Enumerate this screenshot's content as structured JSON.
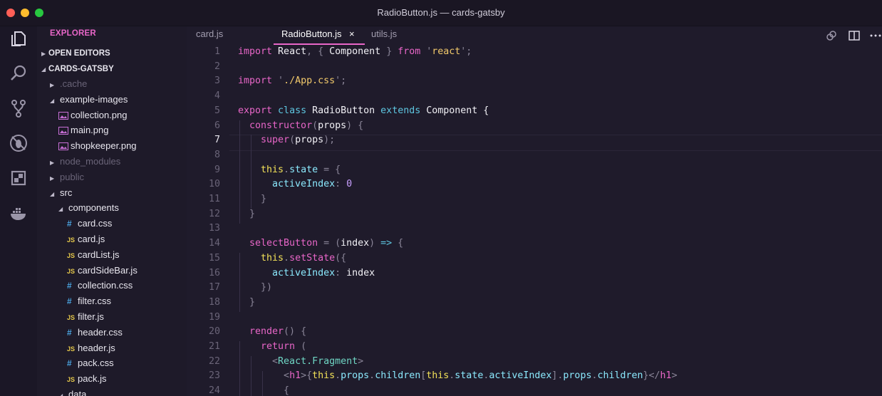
{
  "window": {
    "title": "RadioButton.js — cards-gatsby"
  },
  "activity_bar": [
    "files-icon",
    "search-icon",
    "source-control-icon",
    "debug-icon",
    "extensions-icon",
    "docker-icon"
  ],
  "sidebar": {
    "title": "EXPLORER",
    "open_editors": "OPEN EDITORS",
    "project": "CARDS-GATSBY",
    "items": [
      {
        "label": ".cache",
        "type": "folder-collapsed",
        "depth": 1,
        "dim": true
      },
      {
        "label": "example-images",
        "type": "folder-open",
        "depth": 1
      },
      {
        "label": "collection.png",
        "type": "img",
        "depth": 2
      },
      {
        "label": "main.png",
        "type": "img",
        "depth": 2
      },
      {
        "label": "shopkeeper.png",
        "type": "img",
        "depth": 2
      },
      {
        "label": "node_modules",
        "type": "folder-collapsed",
        "depth": 1,
        "dim": true
      },
      {
        "label": "public",
        "type": "folder-collapsed",
        "depth": 1,
        "dim": true
      },
      {
        "label": "src",
        "type": "folder-open",
        "depth": 1
      },
      {
        "label": "components",
        "type": "folder-open",
        "depth": 2
      },
      {
        "label": "card.css",
        "type": "css",
        "depth": 3
      },
      {
        "label": "card.js",
        "type": "js",
        "depth": 3
      },
      {
        "label": "cardList.js",
        "type": "js",
        "depth": 3
      },
      {
        "label": "cardSideBar.js",
        "type": "js",
        "depth": 3
      },
      {
        "label": "collection.css",
        "type": "css",
        "depth": 3
      },
      {
        "label": "filter.css",
        "type": "css",
        "depth": 3
      },
      {
        "label": "filter.js",
        "type": "js",
        "depth": 3
      },
      {
        "label": "header.css",
        "type": "css",
        "depth": 3
      },
      {
        "label": "header.js",
        "type": "js",
        "depth": 3
      },
      {
        "label": "pack.css",
        "type": "css",
        "depth": 3
      },
      {
        "label": "pack.js",
        "type": "js",
        "depth": 3
      },
      {
        "label": "data",
        "type": "folder-open",
        "depth": 2
      }
    ]
  },
  "tabs": [
    {
      "label": "card.js",
      "active": false
    },
    {
      "label": "RadioButton.js",
      "active": true,
      "close": "×"
    },
    {
      "label": "utils.js",
      "active": false
    }
  ],
  "toolbar_icons": [
    "open-changes-icon",
    "split-editor-icon",
    "more-actions-icon"
  ],
  "editor": {
    "current_line": 7,
    "lines": [
      {
        "n": "1",
        "tokens": [
          [
            "kw",
            "import"
          ],
          [
            "var",
            " React"
          ],
          [
            "pun",
            ", { "
          ],
          [
            "cls",
            "Component"
          ],
          [
            "pun",
            " } "
          ],
          [
            "kw",
            "from"
          ],
          [
            "pun",
            " '"
          ],
          [
            "str",
            "react"
          ],
          [
            "pun",
            "';"
          ]
        ]
      },
      {
        "n": "2",
        "tokens": []
      },
      {
        "n": "3",
        "tokens": [
          [
            "kw",
            "import"
          ],
          [
            "pun",
            " '"
          ],
          [
            "str",
            "./App.css"
          ],
          [
            "pun",
            "';"
          ]
        ]
      },
      {
        "n": "4",
        "tokens": []
      },
      {
        "n": "5",
        "tokens": [
          [
            "kw",
            "export"
          ],
          [
            "kw2",
            " class"
          ],
          [
            "cls",
            " RadioButton"
          ],
          [
            "kw2",
            " extends"
          ],
          [
            "cls",
            " Component"
          ],
          [
            "var",
            " {"
          ]
        ]
      },
      {
        "n": "6",
        "tokens": [
          [
            "fn",
            "  constructor"
          ],
          [
            "pun",
            "("
          ],
          [
            "var",
            "props"
          ],
          [
            "pun",
            ") {"
          ]
        ]
      },
      {
        "n": "7",
        "tokens": [
          [
            "fn",
            "    super"
          ],
          [
            "pun",
            "("
          ],
          [
            "var",
            "props"
          ],
          [
            "pun",
            ");"
          ]
        ]
      },
      {
        "n": "8",
        "tokens": []
      },
      {
        "n": "9",
        "tokens": [
          [
            "this",
            "    this"
          ],
          [
            "pun",
            "."
          ],
          [
            "prop",
            "state"
          ],
          [
            "pun",
            " = {"
          ]
        ]
      },
      {
        "n": "10",
        "tokens": [
          [
            "prop",
            "      activeIndex"
          ],
          [
            "pun",
            ": "
          ],
          [
            "num",
            "0"
          ]
        ]
      },
      {
        "n": "11",
        "tokens": [
          [
            "pun",
            "    }"
          ]
        ]
      },
      {
        "n": "12",
        "tokens": [
          [
            "pun",
            "  }"
          ]
        ]
      },
      {
        "n": "13",
        "tokens": []
      },
      {
        "n": "14",
        "tokens": [
          [
            "fn",
            "  selectButton"
          ],
          [
            "pun",
            " = ("
          ],
          [
            "var",
            "index"
          ],
          [
            "pun",
            ") "
          ],
          [
            "kw2",
            "=>"
          ],
          [
            "pun",
            " {"
          ]
        ]
      },
      {
        "n": "15",
        "tokens": [
          [
            "this",
            "    this"
          ],
          [
            "pun",
            "."
          ],
          [
            "fn",
            "setState"
          ],
          [
            "pun",
            "({"
          ]
        ]
      },
      {
        "n": "16",
        "tokens": [
          [
            "prop",
            "      activeIndex"
          ],
          [
            "pun",
            ": "
          ],
          [
            "var",
            "index"
          ]
        ]
      },
      {
        "n": "17",
        "tokens": [
          [
            "pun",
            "    })"
          ]
        ]
      },
      {
        "n": "18",
        "tokens": [
          [
            "pun",
            "  }"
          ]
        ]
      },
      {
        "n": "19",
        "tokens": []
      },
      {
        "n": "20",
        "tokens": [
          [
            "fn",
            "  render"
          ],
          [
            "pun",
            "() {"
          ]
        ]
      },
      {
        "n": "21",
        "tokens": [
          [
            "kw",
            "    return"
          ],
          [
            "pun",
            " ("
          ]
        ]
      },
      {
        "n": "22",
        "tokens": [
          [
            "pun",
            "      <"
          ],
          [
            "jsx",
            "React.Fragment"
          ],
          [
            "pun",
            ">"
          ]
        ]
      },
      {
        "n": "23",
        "tokens": [
          [
            "pun",
            "        <"
          ],
          [
            "kw",
            "h1"
          ],
          [
            "pun",
            ">{"
          ],
          [
            "this",
            "this"
          ],
          [
            "pun",
            "."
          ],
          [
            "prop",
            "props"
          ],
          [
            "pun",
            "."
          ],
          [
            "prop",
            "children"
          ],
          [
            "pun",
            "["
          ],
          [
            "this",
            "this"
          ],
          [
            "pun",
            "."
          ],
          [
            "prop",
            "state"
          ],
          [
            "pun",
            "."
          ],
          [
            "prop",
            "activeIndex"
          ],
          [
            "pun",
            "]."
          ],
          [
            "prop",
            "props"
          ],
          [
            "pun",
            "."
          ],
          [
            "prop",
            "children"
          ],
          [
            "pun",
            "}</"
          ],
          [
            "kw",
            "h1"
          ],
          [
            "pun",
            ">"
          ]
        ]
      },
      {
        "n": "24",
        "tokens": [
          [
            "pun",
            "        {"
          ]
        ]
      }
    ]
  },
  "colors": {
    "accent": "#e866c8",
    "background": "#1f1b2b"
  }
}
